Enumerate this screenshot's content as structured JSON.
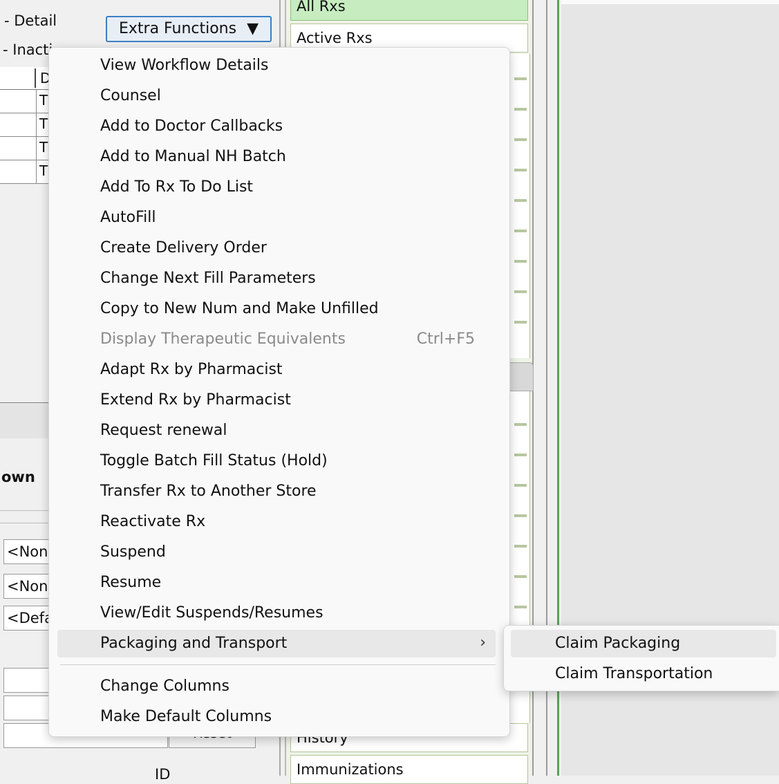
{
  "left_panel": {
    "detail_label": "- Detail",
    "inactive_label": "- Inacti",
    "grid_header_partial": "D",
    "grid_rows": [
      "T",
      "T",
      "T",
      "T"
    ],
    "own_label": "own",
    "combos": [
      "<Non",
      "<Non",
      "<Defa"
    ],
    "reset_button": "Reset",
    "id_label": "ID"
  },
  "extra_functions_button": {
    "label": "Extra Functions",
    "arrow": "▼"
  },
  "nav_tabs": {
    "all_rxs": "All Rxs",
    "active_rxs": "Active Rxs",
    "history": "History",
    "immunizations": "Immunizations"
  },
  "context_menu": {
    "items": [
      {
        "label": "View Workflow Details"
      },
      {
        "label": "Counsel"
      },
      {
        "label": "Add to Doctor Callbacks"
      },
      {
        "label": "Add to Manual NH Batch"
      },
      {
        "label": "Add To Rx To Do List"
      },
      {
        "label": "AutoFill"
      },
      {
        "label": "Create Delivery Order"
      },
      {
        "label": "Change Next Fill Parameters"
      },
      {
        "label": "Copy to New Num and Make Unfilled"
      },
      {
        "label": "Display Therapeutic Equivalents",
        "shortcut": "Ctrl+F5",
        "disabled": true
      },
      {
        "label": "Adapt Rx by Pharmacist"
      },
      {
        "label": "Extend Rx by Pharmacist"
      },
      {
        "label": "Request renewal"
      },
      {
        "label": "Toggle Batch Fill Status (Hold)"
      },
      {
        "label": "Transfer Rx to Another Store"
      },
      {
        "label": "Reactivate Rx"
      },
      {
        "label": "Suspend"
      },
      {
        "label": "Resume"
      },
      {
        "label": "View/Edit Suspends/Resumes"
      },
      {
        "label": "Packaging and Transport",
        "submenu_arrow": "›",
        "highlighted": true
      }
    ],
    "bottom_items": [
      {
        "label": "Change Columns"
      },
      {
        "label": "Make Default Columns"
      }
    ]
  },
  "submenu": {
    "items": [
      {
        "label": "Claim Packaging",
        "highlighted": true
      },
      {
        "label": "Claim Transportation"
      }
    ]
  }
}
